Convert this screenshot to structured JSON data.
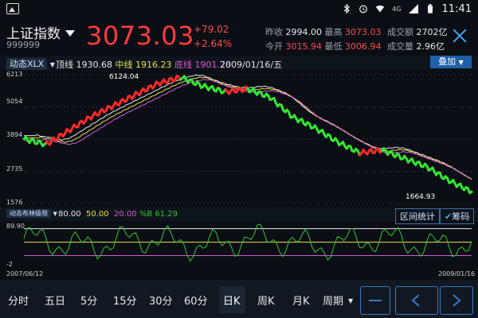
{
  "status_bar": {
    "time": "11:41",
    "network": "4G",
    "icons": [
      "image-icon",
      "bluetooth-icon",
      "alarm-icon",
      "wifi-icon",
      "signal-icon",
      "battery-icon"
    ]
  },
  "header": {
    "title": "上证指数",
    "code": "999999",
    "price": "3073.03",
    "change": "+79.02",
    "change_pct": "+2.64%",
    "stats": [
      {
        "label": "昨收",
        "value": "2994.00",
        "color": "white"
      },
      {
        "label": "最高",
        "value": "3073.03",
        "color": "red"
      },
      {
        "label": "成交额",
        "value": "2702亿",
        "color": "white"
      },
      {
        "label": "今开",
        "value": "3015.94",
        "color": "red"
      },
      {
        "label": "最低",
        "value": "3006.94",
        "color": "red"
      },
      {
        "label": "成交量",
        "value": "2.96亿",
        "color": "white"
      }
    ]
  },
  "indicator_bar": {
    "selector": "动态XLX",
    "top_label": "顶线",
    "top_value": "1930.68",
    "mid_label": "中线",
    "mid_value": "1916.23",
    "bottom_label": "底线",
    "bottom_value": "1901.78",
    "date": "2009/01/16/五",
    "overlay_button": "叠加"
  },
  "chart_data": {
    "type": "line",
    "y_ticks": [
      "6213",
      "5054",
      "3894",
      "2735",
      "1576"
    ],
    "high_label": "6124.04",
    "low_label": "1664.93",
    "start_date": "2007/06/12",
    "end_date": "2009/01/16",
    "x": [
      0,
      5,
      10,
      15,
      20,
      25,
      30,
      35,
      40,
      45,
      50,
      55,
      60,
      65,
      70,
      75,
      80,
      85,
      90,
      95,
      100
    ],
    "series": [
      {
        "values": [
          3900,
          3700,
          4200,
          4700,
          5100,
          5500,
          5900,
          6124,
          5800,
          5600,
          5700,
          5400,
          4700,
          4300,
          3800,
          3400,
          3500,
          3200,
          2900,
          2400,
          2000
        ]
      }
    ],
    "lower_indicator": {
      "selector": "动态布林级限",
      "v1": "80.00",
      "v2": "50.00",
      "v3": "20.00",
      "pb_label": "%B",
      "pb_value": "61.29",
      "axis_top": "89.90",
      "axis_bottom": "-2",
      "buttons": [
        "区间统计",
        "筹码"
      ]
    }
  },
  "periods": [
    "分时",
    "五日",
    "5分",
    "15分",
    "30分",
    "60分",
    "日K",
    "周K",
    "月K",
    "周期"
  ],
  "active_period": "日K",
  "nav_buttons": [
    "minus",
    "prev",
    "next"
  ],
  "colors": {
    "up": "#ff2a2a",
    "down": "#33e633",
    "accent": "#3a78c2"
  }
}
